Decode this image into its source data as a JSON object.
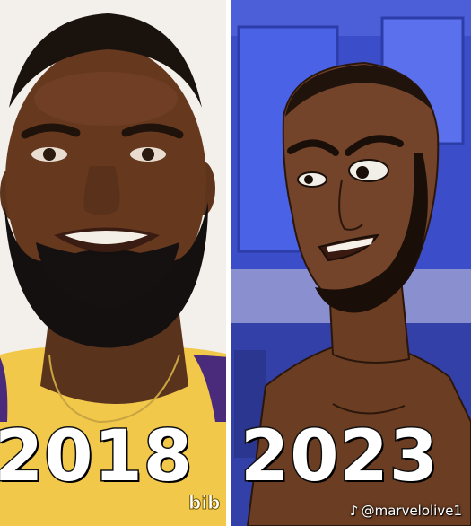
{
  "captions": {
    "left_year": "2018",
    "right_year": "2023"
  },
  "jersey": {
    "sponsor_text": "bib"
  },
  "watermark": {
    "icon": "tiktok-note-icon",
    "text": "@marvelolive1"
  },
  "colors": {
    "jersey_gold": "#f2c84b",
    "jersey_purple": "#4a2a7a",
    "cartoon_background": "#3b4dc9",
    "cartoon_skin": "#6b3d22"
  }
}
